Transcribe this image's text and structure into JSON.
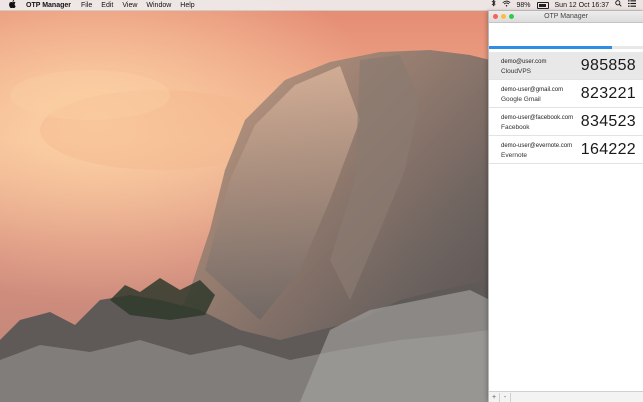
{
  "menubar": {
    "app_name": "OTP Manager",
    "menus": [
      "File",
      "Edit",
      "View",
      "Window",
      "Help"
    ],
    "battery": "98%",
    "clock": "Sun 12 Oct  16:37"
  },
  "window": {
    "title": "OTP Manager",
    "progress": 0.8,
    "accounts": [
      {
        "email": "demo@user.com",
        "service": "CloudVPS",
        "code": "985858",
        "selected": true
      },
      {
        "email": "demo-user@gmail.com",
        "service": "Google Gmail",
        "code": "823221",
        "selected": false
      },
      {
        "email": "demo-user@facebook.com",
        "service": "Facebook",
        "code": "834523",
        "selected": false
      },
      {
        "email": "demo-user@evernote.com",
        "service": "Evernote",
        "code": "164222",
        "selected": false
      }
    ],
    "bottom_buttons": [
      "+",
      "-"
    ]
  },
  "icons": {
    "apple": "apple-icon",
    "bluetooth": "bluetooth-icon",
    "wifi": "wifi-icon",
    "battery": "battery-icon",
    "search": "search-icon",
    "notifications": "notification-center-icon"
  },
  "colors": {
    "progress": "#2f8de4",
    "close": "#fc605b",
    "minimize": "#fdbc40",
    "zoom": "#34c84a"
  }
}
